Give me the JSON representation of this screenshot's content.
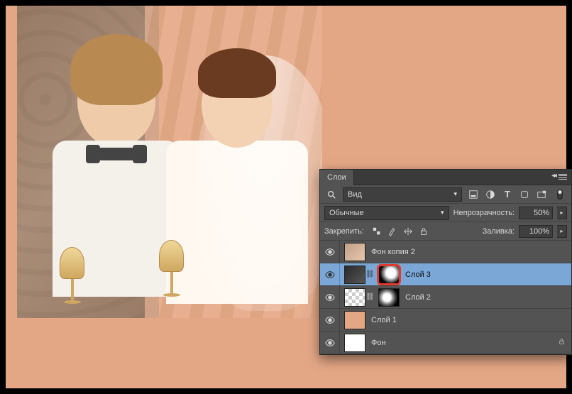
{
  "panel": {
    "title": "Слои",
    "filter_label": "Вид",
    "filter_icons": [
      "image-icon",
      "adjust-icon",
      "type-icon",
      "shape-icon",
      "smart-icon"
    ],
    "blend_mode": "Обычные",
    "opacity_label": "Непрозрачность:",
    "opacity_value": "50%",
    "lock_label": "Закрепить:",
    "fill_label": "Заливка:",
    "fill_value": "100%"
  },
  "layers": [
    {
      "name": "Фон копия 2",
      "visible": true,
      "selected": false,
      "thumb": "photo",
      "mask": null,
      "locked": false
    },
    {
      "name": "Слой 3",
      "visible": true,
      "selected": true,
      "thumb": "dark",
      "mask": "mask",
      "locked": false,
      "highlight_mask": true
    },
    {
      "name": "Слой 2",
      "visible": true,
      "selected": false,
      "thumb": "check",
      "mask": "mask2",
      "locked": false
    },
    {
      "name": "Слой 1",
      "visible": true,
      "selected": false,
      "thumb": "peach",
      "mask": null,
      "locked": false
    },
    {
      "name": "Фон",
      "visible": true,
      "selected": false,
      "thumb": "white",
      "mask": null,
      "locked": true
    }
  ]
}
